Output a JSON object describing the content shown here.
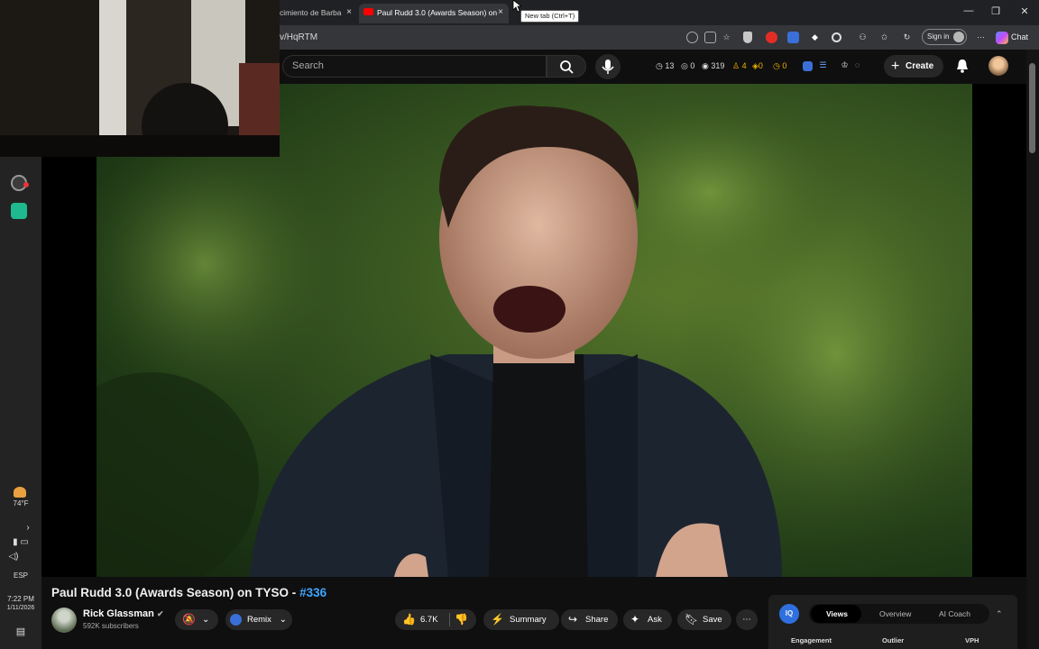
{
  "browser": {
    "tabs": [
      {
        "title": "cimiento de Barba"
      },
      {
        "title": "Paul Rudd 3.0 (Awards Season) on"
      }
    ],
    "close_glyph": "×",
    "tooltip": "New tab (Ctrl+T)",
    "url": "v/HqRTM",
    "sign_in": "Sign in",
    "chat": "Chat",
    "window_controls": [
      "—",
      "❐",
      "✕"
    ]
  },
  "youtube_header": {
    "search_placeholder": "Search",
    "stats": [
      "13",
      "0",
      "319",
      "4",
      "0",
      "0"
    ],
    "create_label": "Create"
  },
  "taskbar": {
    "weather": "74°F",
    "lang": "ESP",
    "time": "7:22 PM",
    "date": "1/11/2026"
  },
  "video": {
    "title": "Paul Rudd 3.0 (Awards Season) on TYSO - ",
    "hashtag": "#336",
    "channel": "Rick Glassman",
    "subscribers": "592K subscribers"
  },
  "actions": {
    "remix": "Remix",
    "likes": "6.7K",
    "summary": "Summary",
    "share": "Share",
    "ask": "Ask",
    "save": "Save",
    "more": "⋯"
  },
  "tubeiq": {
    "badge": "IQ",
    "tabs": [
      "Views",
      "Overview",
      "AI Coach"
    ],
    "labels": [
      "Engagement",
      "Outlier",
      "VPH"
    ]
  },
  "colors": {
    "accent_blue": "#3ea6ff",
    "yt_red": "#ff0000"
  }
}
